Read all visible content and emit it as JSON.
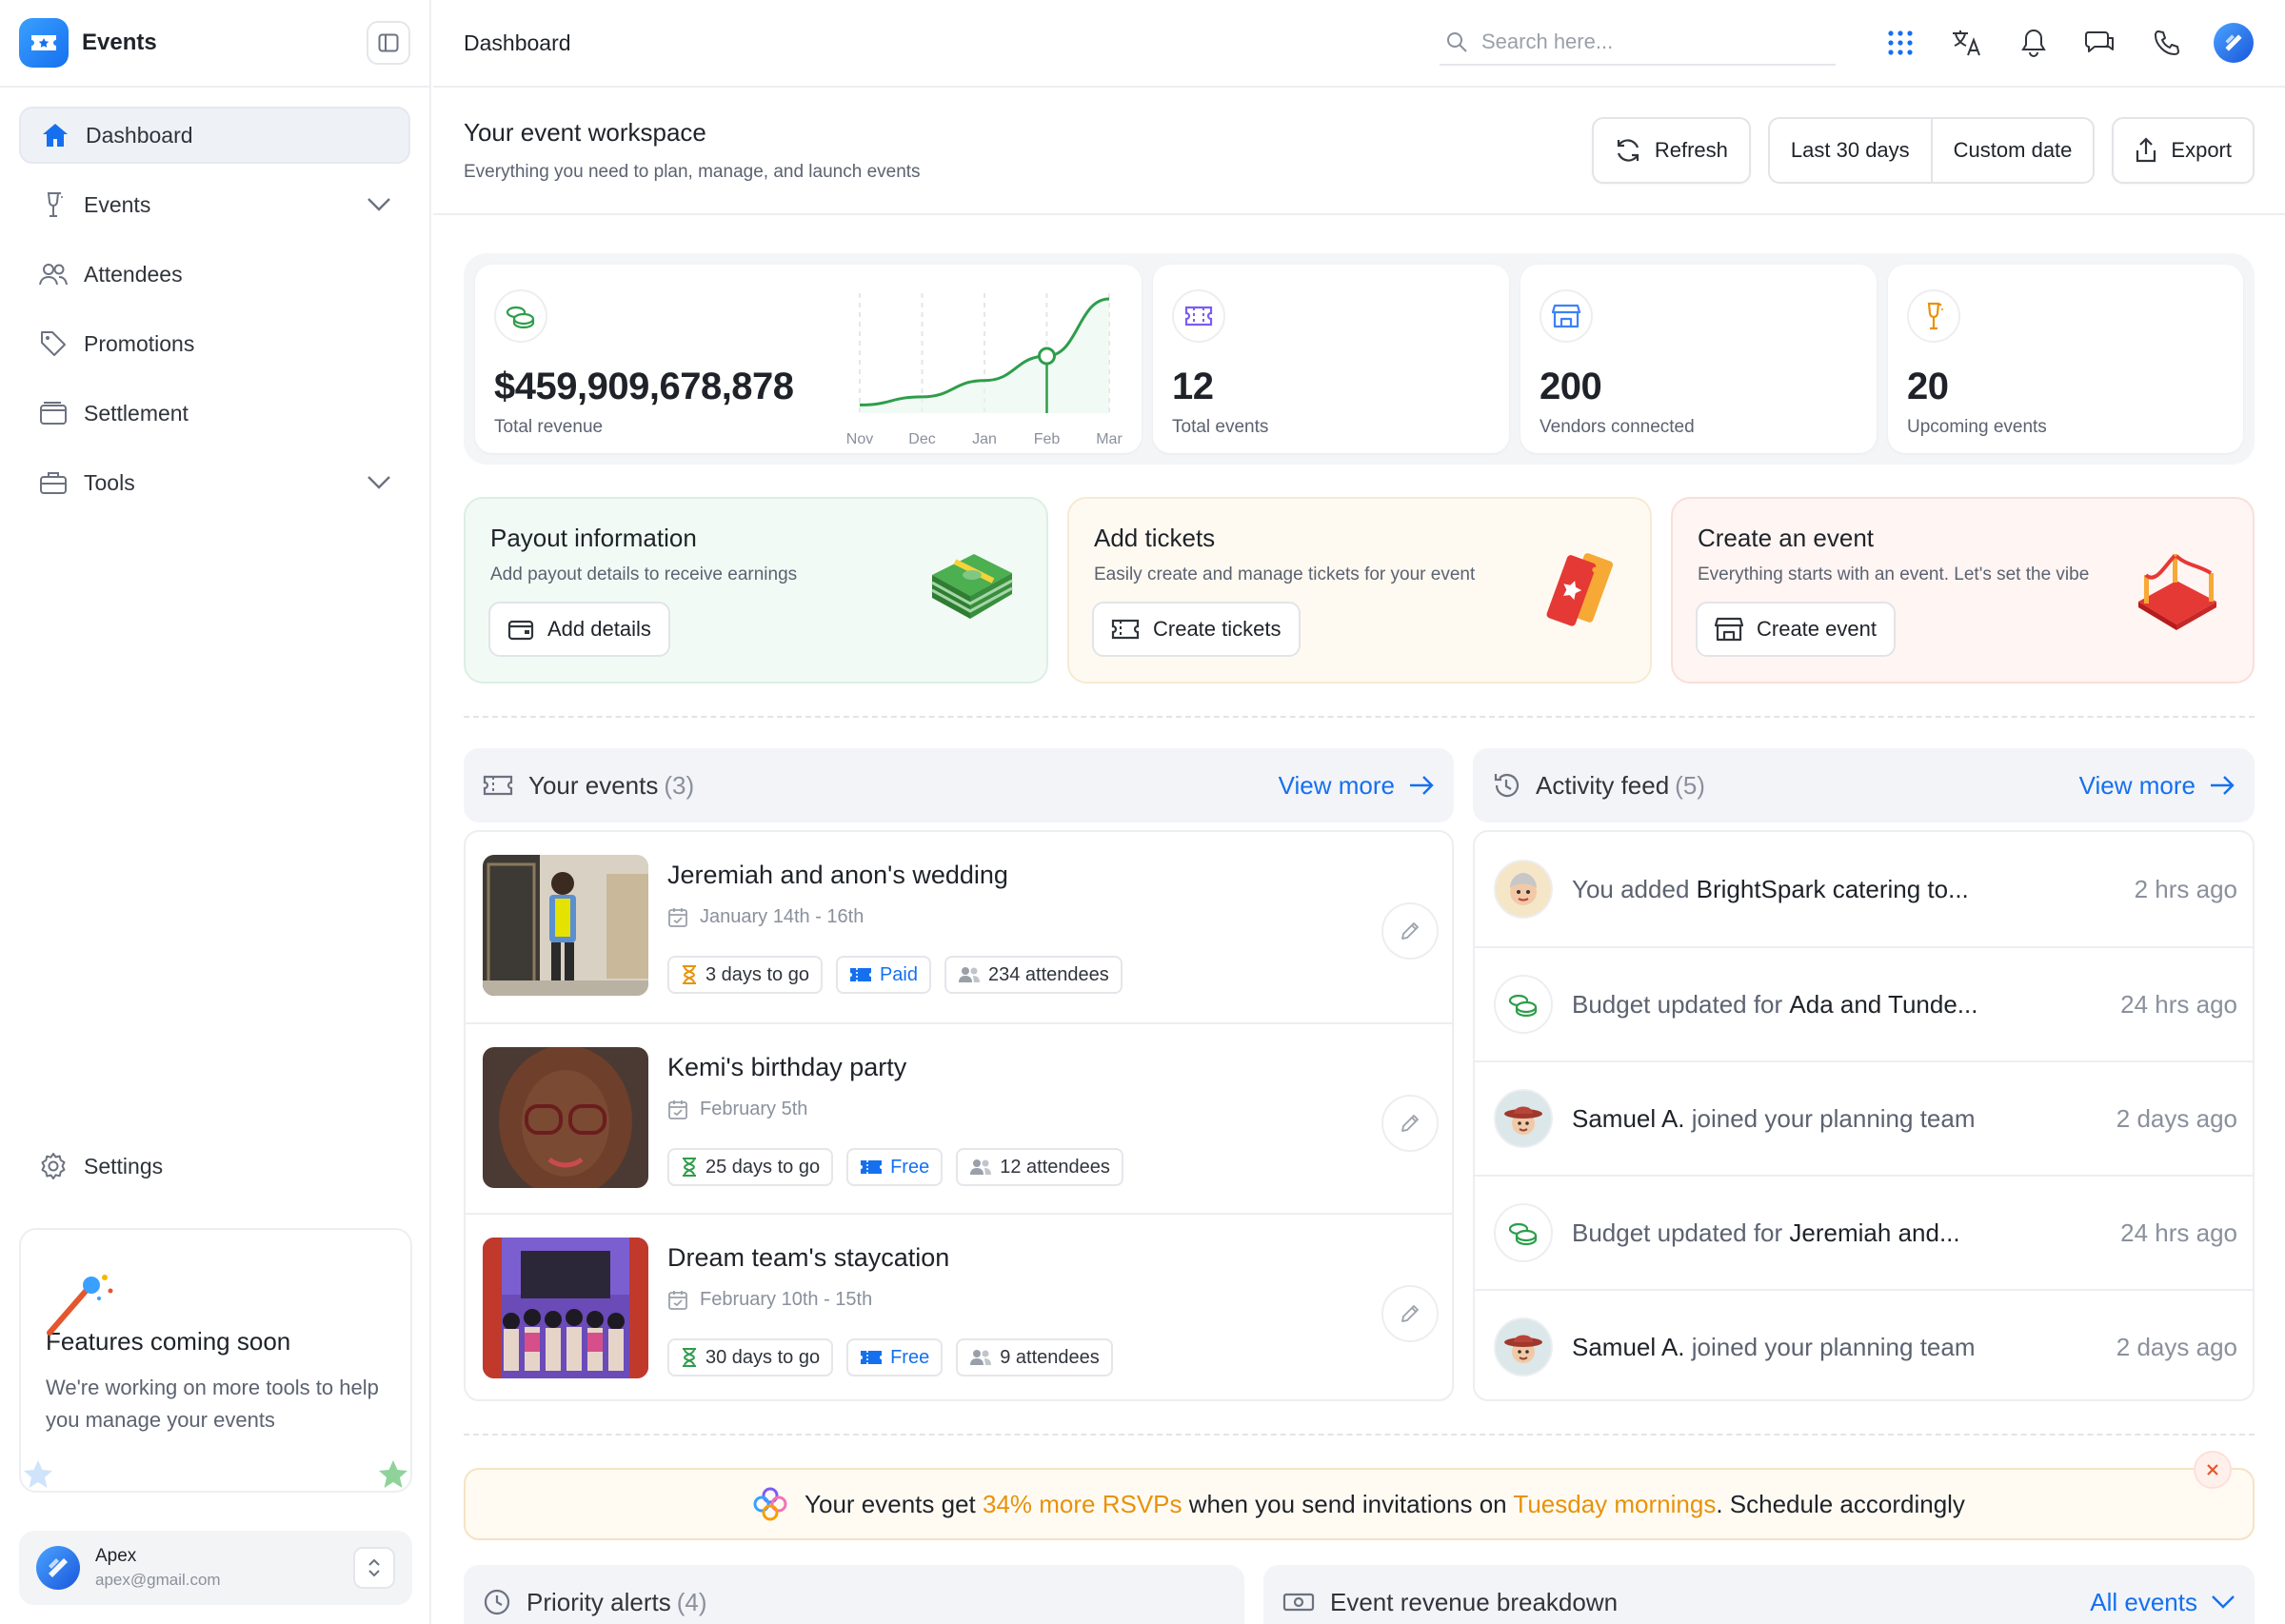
{
  "app": {
    "name": "Events"
  },
  "sidebar": {
    "items": [
      {
        "label": "Dashboard",
        "icon": "home-icon",
        "active": true
      },
      {
        "label": "Events",
        "icon": "champagne-icon",
        "expandable": true
      },
      {
        "label": "Attendees",
        "icon": "users-icon"
      },
      {
        "label": "Promotions",
        "icon": "tag-icon"
      },
      {
        "label": "Settlement",
        "icon": "wallet-icon"
      },
      {
        "label": "Tools",
        "icon": "briefcase-icon",
        "expandable": true
      }
    ],
    "settings_label": "Settings",
    "coming_soon": {
      "title": "Features coming soon",
      "text": "We're working on more tools to help you manage your events"
    },
    "user": {
      "name": "Apex",
      "email": "apex@gmail.com"
    }
  },
  "topbar": {
    "breadcrumb": "Dashboard",
    "search_placeholder": "Search here..."
  },
  "workspace": {
    "title": "Your event workspace",
    "subtitle": "Everything you need to plan, manage, and launch events",
    "refresh_label": "Refresh",
    "range_label": "Last 30 days",
    "custom_label": "Custom date",
    "export_label": "Export"
  },
  "stats": {
    "revenue": {
      "value": "$459,909,678,878",
      "label": "Total revenue"
    },
    "events": {
      "value": "12",
      "label": "Total events"
    },
    "vendors": {
      "value": "200",
      "label": "Vendors connected"
    },
    "upcoming": {
      "value": "20",
      "label": "Upcoming events"
    }
  },
  "chart_data": {
    "type": "line",
    "categories": [
      "Nov",
      "Dec",
      "Jan",
      "Feb",
      "Mar"
    ],
    "values": [
      10,
      20,
      40,
      70,
      140
    ],
    "highlight": "Feb",
    "xlabel": "",
    "ylabel": "",
    "grid": "vertical dashed",
    "color": "#2e9d4b"
  },
  "promos": [
    {
      "title": "Payout information",
      "subtitle": "Add payout details to receive earnings",
      "button": "Add details"
    },
    {
      "title": "Add tickets",
      "subtitle": "Easily create and manage tickets for your event",
      "button": "Create tickets"
    },
    {
      "title": "Create an event",
      "subtitle": "Everything starts with an event. Let's set the vibe",
      "button": "Create event"
    }
  ],
  "events_panel": {
    "title": "Your events",
    "count": "(3)",
    "view_more": "View more",
    "items": [
      {
        "title": "Jeremiah and anon's wedding",
        "date": "January 14th - 16th",
        "countdown": "3 days to go",
        "type": "Paid",
        "attendees": "234 attendees"
      },
      {
        "title": "Kemi's birthday party",
        "date": "February 5th",
        "countdown": "25 days to go",
        "type": "Free",
        "attendees": "12 attendees"
      },
      {
        "title": "Dream team's staycation",
        "date": "February 10th - 15th",
        "countdown": "30 days to go",
        "type": "Free",
        "attendees": "9 attendees"
      }
    ]
  },
  "activity_panel": {
    "title": "Activity feed",
    "count": "(5)",
    "view_more": "View more",
    "items": [
      {
        "prefix": "You added ",
        "bold": "BrightSpark catering to...",
        "suffix": "",
        "time": "2 hrs ago",
        "avatar": "memoji-avatar"
      },
      {
        "prefix": "Budget updated for ",
        "bold": "Ada and Tunde...",
        "suffix": "",
        "time": "24 hrs ago",
        "avatar": "money-icon"
      },
      {
        "prefix": "",
        "bold": "Samuel A.",
        "suffix": " joined your planning team",
        "time": "2 days ago",
        "avatar": "cowboy-avatar"
      },
      {
        "prefix": "Budget updated for ",
        "bold": "Jeremiah and...",
        "suffix": "",
        "time": "24 hrs ago",
        "avatar": "money-icon"
      },
      {
        "prefix": "",
        "bold": "Samuel A.",
        "suffix": " joined your planning team",
        "time": "2 days ago",
        "avatar": "cowboy-avatar"
      }
    ]
  },
  "tip": {
    "part1": "Your events get ",
    "highlight1": "34% more RSVPs",
    "part2": " when you send invitations on ",
    "highlight2": "Tuesday mornings",
    "part3": ". Schedule accordingly",
    "highlight_color": "#e8920a"
  },
  "bottom_panels": {
    "alerts_title": "Priority alerts",
    "alerts_count": "(4)",
    "revenue_title": "Event revenue breakdown",
    "revenue_filter": "All events"
  },
  "colors": {
    "accent": "#1570ef",
    "success": "#2e9d4b",
    "warning": "#e8920a"
  }
}
